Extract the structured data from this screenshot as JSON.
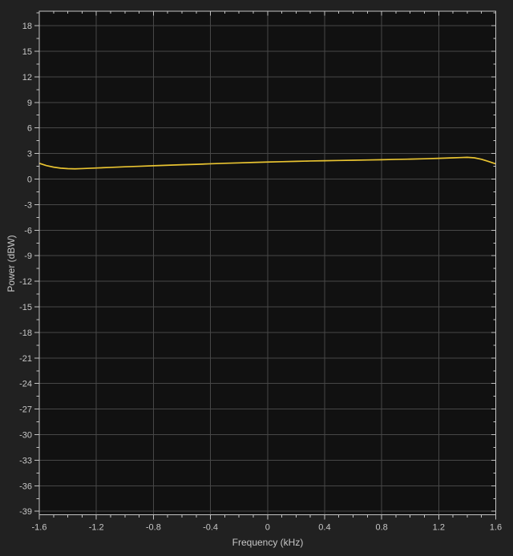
{
  "window": {
    "kind": "spectrum-analyzer-plot"
  },
  "colors": {
    "figure_bg": "#212121",
    "axes_bg": "#111111",
    "grid": "#474747",
    "axis": "#c2c2c2",
    "text": "#c7c7c7",
    "line": "#e8c331"
  },
  "chart_data": {
    "type": "line",
    "title": "",
    "xlabel": "Frequency (kHz)",
    "ylabel": "Power (dBW)",
    "xlim": [
      -1.6,
      1.6
    ],
    "ylim": [
      -39.4,
      19.7
    ],
    "grid": true,
    "legend_position": "none",
    "xticks": [
      -1.6,
      -1.2,
      -0.8,
      -0.4,
      0,
      0.4,
      0.8,
      1.2,
      1.6
    ],
    "xtick_labels": [
      "-1.6",
      "-1.2",
      "-0.8",
      "-0.4",
      "0",
      "0.4",
      "0.8",
      "1.2",
      "1.6"
    ],
    "yticks": [
      18,
      15,
      12,
      9,
      6,
      3,
      0,
      -3,
      -6,
      -9,
      -12,
      -15,
      -18,
      -21,
      -24,
      -27,
      -30,
      -33,
      -36,
      -39
    ],
    "ytick_labels": [
      "18",
      "15",
      "12",
      "9",
      "6",
      "3",
      "0",
      "-3",
      "-6",
      "-9",
      "-12",
      "-15",
      "-18",
      "-21",
      "-24",
      "-27",
      "-30",
      "-33",
      "-36",
      "-39"
    ],
    "x_minor_step": 0.1,
    "y_minor_step": 1.5,
    "series": [
      {
        "name": "power-spectrum",
        "color": "#e8c331",
        "x": [
          -1.6,
          -1.55,
          -1.5,
          -1.45,
          -1.4,
          -1.35,
          -1.3,
          -1.2,
          -1.1,
          -1.0,
          -0.9,
          -0.8,
          -0.7,
          -0.6,
          -0.5,
          -0.4,
          -0.3,
          -0.2,
          -0.1,
          0,
          0.1,
          0.2,
          0.3,
          0.4,
          0.5,
          0.6,
          0.7,
          0.8,
          0.9,
          1.0,
          1.1,
          1.2,
          1.3,
          1.35,
          1.4,
          1.45,
          1.5,
          1.55,
          1.6
        ],
        "y": [
          1.85,
          1.58,
          1.4,
          1.28,
          1.22,
          1.2,
          1.23,
          1.3,
          1.37,
          1.44,
          1.5,
          1.56,
          1.62,
          1.68,
          1.73,
          1.79,
          1.85,
          1.9,
          1.95,
          2.0,
          2.04,
          2.08,
          2.12,
          2.15,
          2.18,
          2.21,
          2.24,
          2.27,
          2.31,
          2.34,
          2.38,
          2.43,
          2.49,
          2.52,
          2.55,
          2.49,
          2.32,
          2.06,
          1.78
        ]
      }
    ]
  }
}
